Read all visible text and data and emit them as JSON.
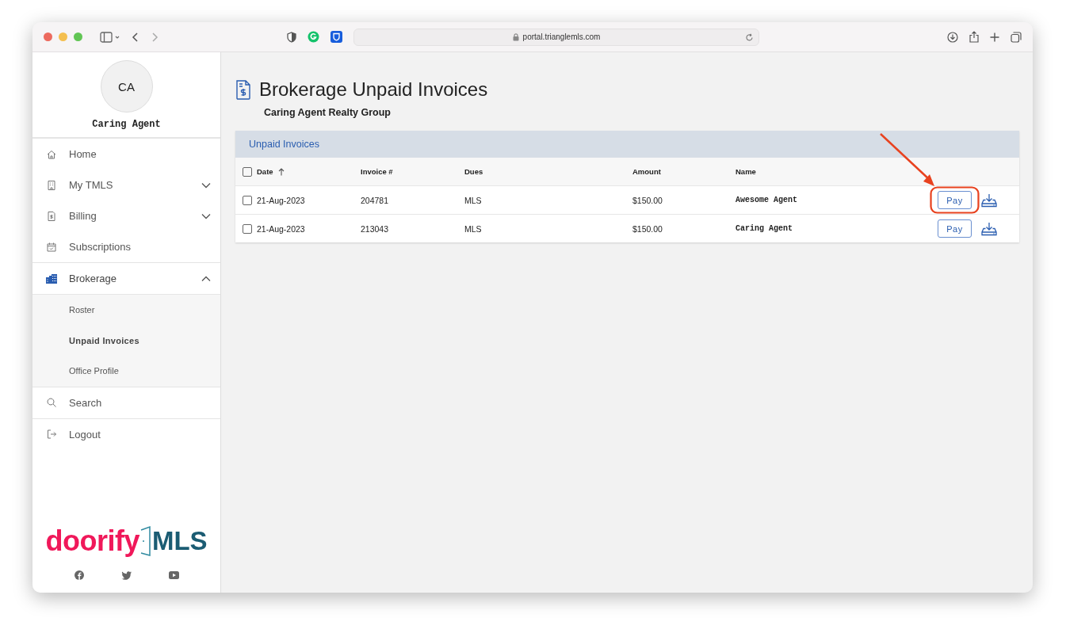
{
  "browser": {
    "url": "portal.trianglemls.com"
  },
  "profile": {
    "initials": "CA",
    "name": "Caring Agent"
  },
  "sidebar": {
    "items": [
      {
        "label": "Home",
        "selected": false
      },
      {
        "label": "My TMLS",
        "selected": false,
        "expanded": false
      },
      {
        "label": "Billing",
        "selected": false,
        "expanded": false
      },
      {
        "label": "Subscriptions",
        "selected": false
      },
      {
        "label": "Brokerage",
        "selected": true,
        "expanded": true,
        "children": [
          {
            "label": "Roster",
            "selected": false
          },
          {
            "label": "Unpaid Invoices",
            "selected": true
          },
          {
            "label": "Office Profile",
            "selected": false
          }
        ]
      },
      {
        "label": "Search",
        "selected": false
      },
      {
        "label": "Logout",
        "selected": false
      }
    ]
  },
  "logo": {
    "word": "doorify",
    "suffix": "MLS"
  },
  "page": {
    "title": "Brokerage Unpaid Invoices",
    "subtitle": "Caring Agent Realty Group"
  },
  "table": {
    "title": "Unpaid Invoices",
    "all_checked": false,
    "columns": [
      {
        "label": "Date",
        "sorted": true
      },
      {
        "label": "Invoice #",
        "sorted": false
      },
      {
        "label": "Dues",
        "sorted": false
      },
      {
        "label": "Amount",
        "sorted": false
      },
      {
        "label": "Name",
        "sorted": false
      }
    ],
    "rows": [
      {
        "checked": false,
        "date": "21-Aug-2023",
        "invoice": "204781",
        "dues": "MLS",
        "amount": "$150.00",
        "name": "Awesome Agent",
        "action": "Pay",
        "highlighted": true
      },
      {
        "checked": false,
        "date": "21-Aug-2023",
        "invoice": "213043",
        "dues": "MLS",
        "amount": "$150.00",
        "name": "Caring Agent",
        "action": "Pay",
        "highlighted": false
      }
    ]
  }
}
